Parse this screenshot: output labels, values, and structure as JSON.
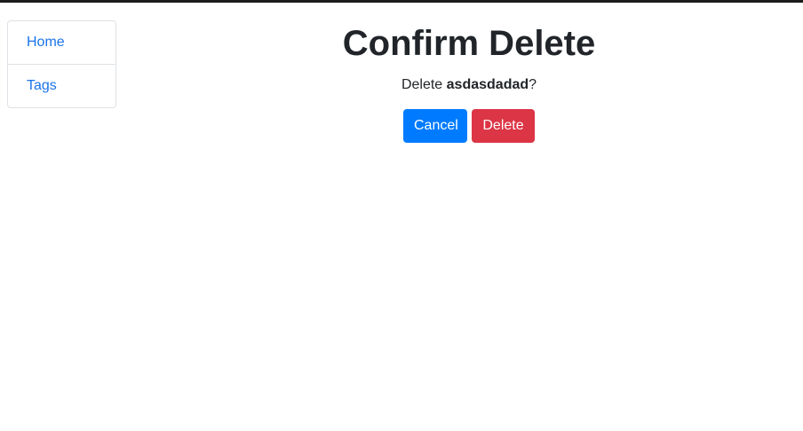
{
  "nav": {
    "items": [
      {
        "label": "Home"
      },
      {
        "label": "Tags"
      }
    ]
  },
  "main": {
    "title": "Confirm Delete",
    "prompt_prefix": "Delete ",
    "item_name": "asdasdadad",
    "prompt_suffix": "?",
    "cancel_label": "Cancel",
    "delete_label": "Delete"
  },
  "colors": {
    "primary": "#007bff",
    "danger": "#dc3545",
    "link": "#1a73e8"
  }
}
